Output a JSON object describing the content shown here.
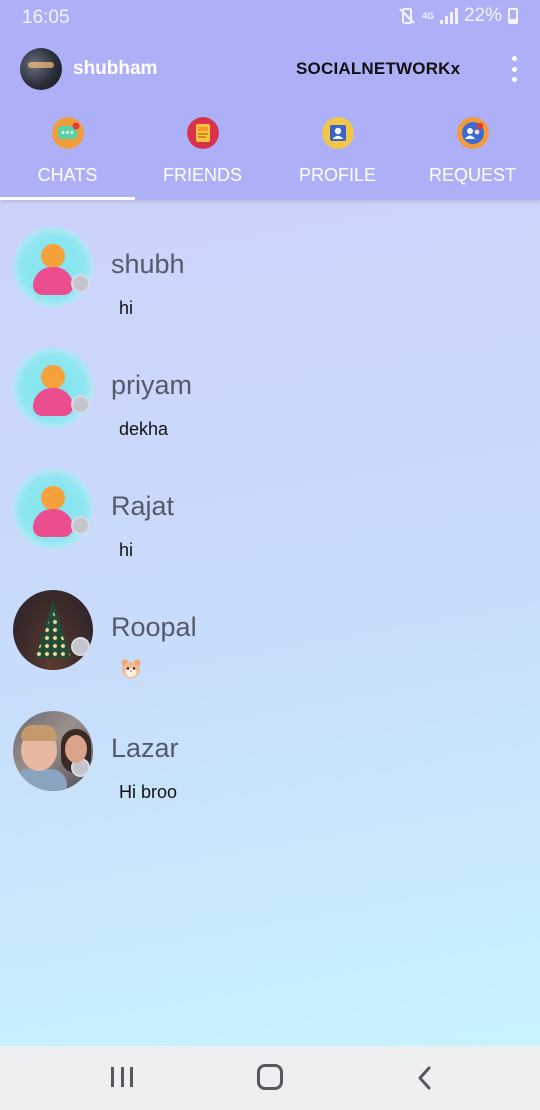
{
  "status_bar": {
    "time": "16:05",
    "network_label": "4G",
    "battery": "22%"
  },
  "app_bar": {
    "username": "shubham",
    "title": "SOCIALNETWORKx"
  },
  "tabs": [
    {
      "label": "CHATS",
      "icon": "chat-bubble-icon",
      "selected": true
    },
    {
      "label": "FRIENDS",
      "icon": "contacts-book-icon",
      "selected": false
    },
    {
      "label": "PROFILE",
      "icon": "profile-card-icon",
      "selected": false
    },
    {
      "label": "REQUEST",
      "icon": "friend-request-icon",
      "selected": false
    }
  ],
  "chats": [
    {
      "name": "shubh",
      "message": "hi",
      "avatar": "default-avatar-icon",
      "online": false
    },
    {
      "name": "priyam",
      "message": "dekha",
      "avatar": "default-avatar-icon",
      "online": false
    },
    {
      "name": "Rajat",
      "message": "hi",
      "avatar": "default-avatar-icon",
      "online": false
    },
    {
      "name": "Roopal",
      "message": "",
      "avatar": "christmas-tree-photo",
      "online": false,
      "message_icon": "hamster-emoji-icon"
    },
    {
      "name": "Lazar",
      "message": "Hi broo",
      "avatar": "people-photo",
      "online": false
    }
  ],
  "colors": {
    "header": "#aeb0f7",
    "tab_indicator": "#ffffff",
    "chat_name": "#555a68",
    "online_dot": "#c4c6cc",
    "navbar": "#eeeff1"
  }
}
